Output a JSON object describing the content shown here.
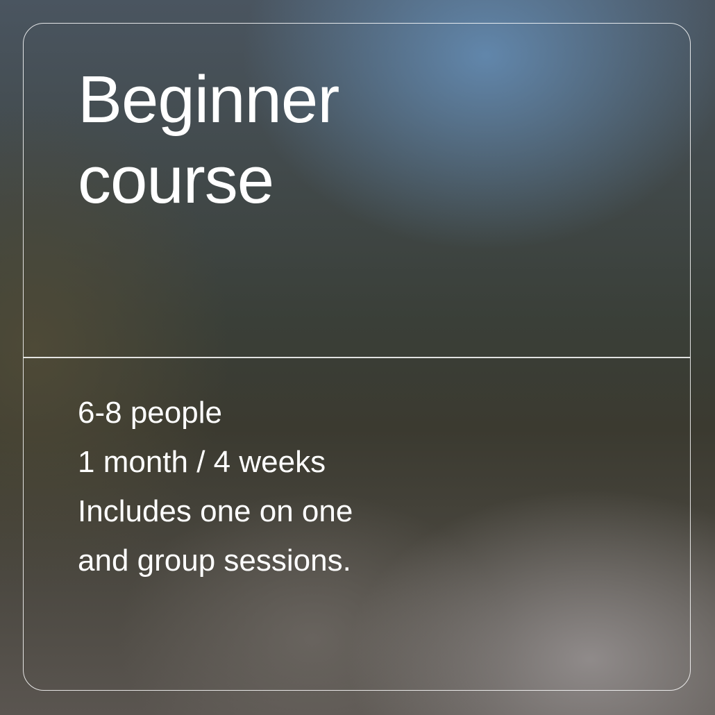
{
  "card": {
    "title_line1": "Beginner",
    "title_line2": "course",
    "details": [
      "6-8 people",
      "1 month / 4 weeks",
      "Includes one on one",
      "and group sessions."
    ]
  }
}
